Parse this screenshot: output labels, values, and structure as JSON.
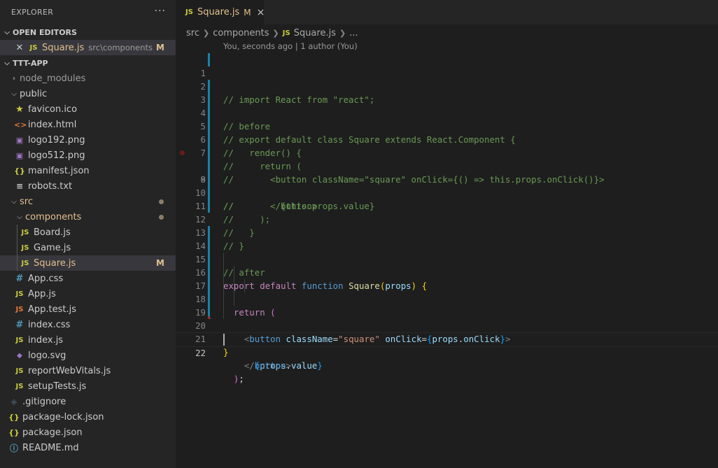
{
  "explorer": {
    "title": "EXPLORER",
    "more": "···",
    "open_editors": {
      "title": "OPEN EDITORS",
      "items": [
        {
          "name": "Square.js",
          "path": "src\\components",
          "status": "M"
        }
      ]
    },
    "project": {
      "title": "TTT-APP",
      "node_modules": "node_modules",
      "public": {
        "name": "public",
        "files": [
          "favicon.ico",
          "index.html",
          "logo192.png",
          "logo512.png",
          "manifest.json",
          "robots.txt"
        ]
      },
      "src": {
        "name": "src",
        "components": {
          "name": "components",
          "files": [
            "Board.js",
            "Game.js",
            "Square.js"
          ],
          "square_status": "M"
        },
        "files": [
          "App.css",
          "App.js",
          "App.test.js",
          "index.css",
          "index.js",
          "logo.svg",
          "reportWebVitals.js",
          "setupTests.js"
        ]
      },
      "root_files": [
        ".gitignore",
        "package-lock.json",
        "package.json",
        "README.md"
      ]
    }
  },
  "tab": {
    "label": "Square.js",
    "status": "M",
    "close": "×",
    "icon": "JS"
  },
  "breadcrumb": [
    "src",
    "components",
    "Square.js",
    "..."
  ],
  "codelens": "You, seconds ago | 1 author (You)",
  "code_lines": [
    "// import React from \"react\";",
    "",
    "// before",
    "// export default class Square extends React.Component {",
    "//   render() {",
    "//     return (",
    "//       <button className=\"square\" onClick={() => this.props.onClick()}>",
    "//         {this.props.value}",
    "//       </button>",
    "//     );",
    "//   }",
    "// }",
    "",
    "// after",
    "export default function Square(props) {",
    "  return (",
    "    <button className=\"square\" onClick={props.onClick}>",
    "      {props.value}",
    "    </button>",
    "  );",
    "}",
    ""
  ],
  "line_numbers": [
    "1",
    "2",
    "3",
    "4",
    "5",
    "6",
    "7",
    "8",
    "9",
    "10",
    "11",
    "12",
    "13",
    "14",
    "15",
    "16",
    "17",
    "18",
    "19",
    "20",
    "21",
    "22"
  ],
  "colors": {
    "modified": "#e2c08d",
    "gutter_change": "#1b81a8",
    "js_icon": "#cbcb41"
  }
}
